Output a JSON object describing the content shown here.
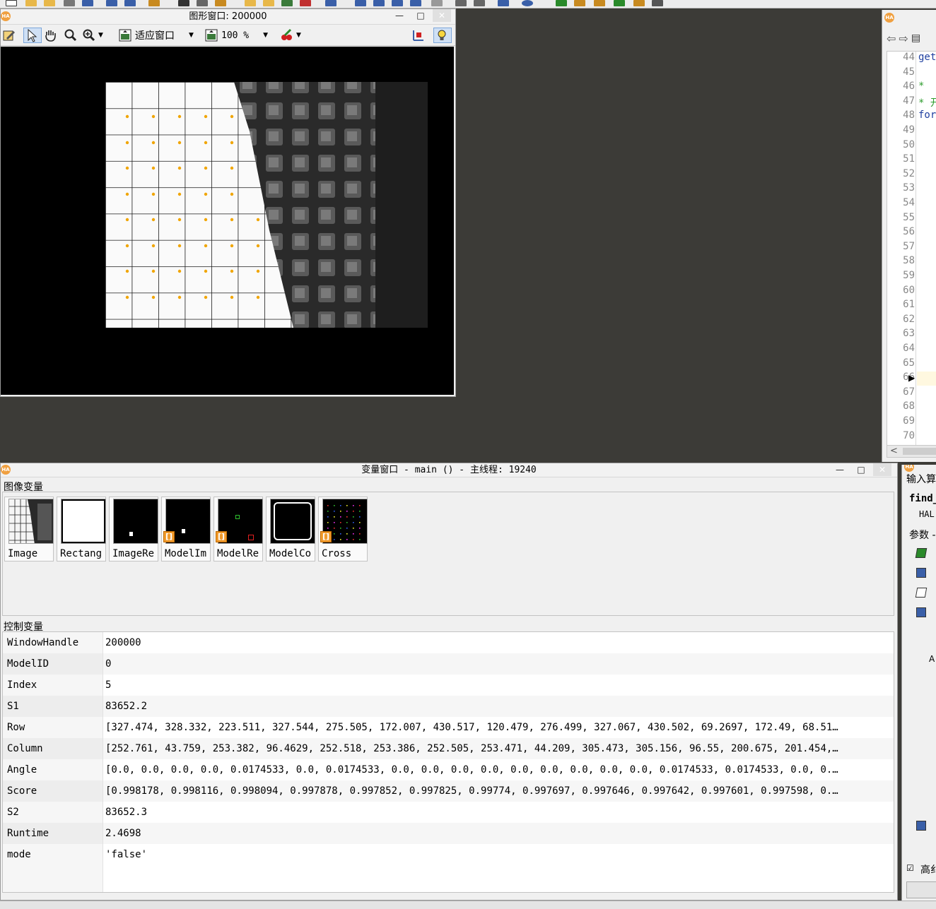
{
  "graphics_window": {
    "title": "图形窗口: 200000",
    "toolbar": {
      "fit_label": "适应窗口",
      "zoom_label": "100 %"
    }
  },
  "editor": {
    "lines": [
      {
        "num": "44",
        "code": "get"
      },
      {
        "num": "45",
        "code": ""
      },
      {
        "num": "46",
        "code": "*"
      },
      {
        "num": "47",
        "code": "* 开"
      },
      {
        "num": "48",
        "code": "for"
      },
      {
        "num": "49",
        "code": ""
      },
      {
        "num": "50",
        "code": ""
      },
      {
        "num": "51",
        "code": ""
      },
      {
        "num": "52",
        "code": ""
      },
      {
        "num": "53",
        "code": ""
      },
      {
        "num": "54",
        "code": ""
      },
      {
        "num": "55",
        "code": ""
      },
      {
        "num": "56",
        "code": ""
      },
      {
        "num": "57",
        "code": ""
      },
      {
        "num": "58",
        "code": ""
      },
      {
        "num": "59",
        "code": ""
      },
      {
        "num": "60",
        "code": ""
      },
      {
        "num": "61",
        "code": ""
      },
      {
        "num": "62",
        "code": ""
      },
      {
        "num": "63",
        "code": ""
      },
      {
        "num": "64",
        "code": ""
      },
      {
        "num": "65",
        "code": ""
      },
      {
        "num": "66",
        "code": ""
      },
      {
        "num": "67",
        "code": ""
      },
      {
        "num": "68",
        "code": ""
      },
      {
        "num": "69",
        "code": ""
      },
      {
        "num": "70",
        "code": ""
      }
    ]
  },
  "variable_window": {
    "title": "变量窗口 - main () - 主线程: 19240",
    "image_section_label": "图像变量",
    "control_section_label": "控制变量",
    "image_vars": [
      "Image",
      "Rectang",
      "ImageRe",
      "ModelIm",
      "ModelRe",
      "ModelCo",
      "Cross"
    ],
    "control_vars": [
      {
        "name": "WindowHandle",
        "value": "200000"
      },
      {
        "name": "ModelID",
        "value": "0"
      },
      {
        "name": "Index",
        "value": "5"
      },
      {
        "name": "S1",
        "value": "83652.2"
      },
      {
        "name": "Row",
        "value": "[327.474, 328.332, 223.511, 327.544, 275.505, 172.007, 430.517, 120.479, 276.499, 327.067, 430.502, 69.2697, 172.49, 68.51…"
      },
      {
        "name": "Column",
        "value": "[252.761, 43.759, 253.382, 96.4629, 252.518, 253.386, 252.505, 253.471, 44.209, 305.473, 305.156, 96.55, 200.675, 201.454,…"
      },
      {
        "name": "Angle",
        "value": "[0.0, 0.0, 0.0, 0.0, 0.0174533, 0.0, 0.0174533, 0.0, 0.0, 0.0, 0.0, 0.0, 0.0, 0.0, 0.0, 0.0, 0.0174533, 0.0174533, 0.0, 0.…"
      },
      {
        "name": "Score",
        "value": "[0.998178, 0.998116, 0.998094, 0.997878, 0.997852, 0.997825, 0.99774, 0.997697, 0.997646, 0.997642, 0.997601, 0.997598, 0.…"
      },
      {
        "name": "S2",
        "value": "83652.3"
      },
      {
        "name": "Runtime",
        "value": "2.4698"
      },
      {
        "name": "mode",
        "value": "'false'"
      }
    ]
  },
  "operator_panel": {
    "header": "输入算",
    "op_name": "find_",
    "op_sub": "HAL",
    "params_label": "参数 -",
    "advanced_label": "高纟"
  },
  "colors": {
    "desktop": "#3c3b37",
    "marker": "#f0a500",
    "selection": "#cfe0f5"
  }
}
